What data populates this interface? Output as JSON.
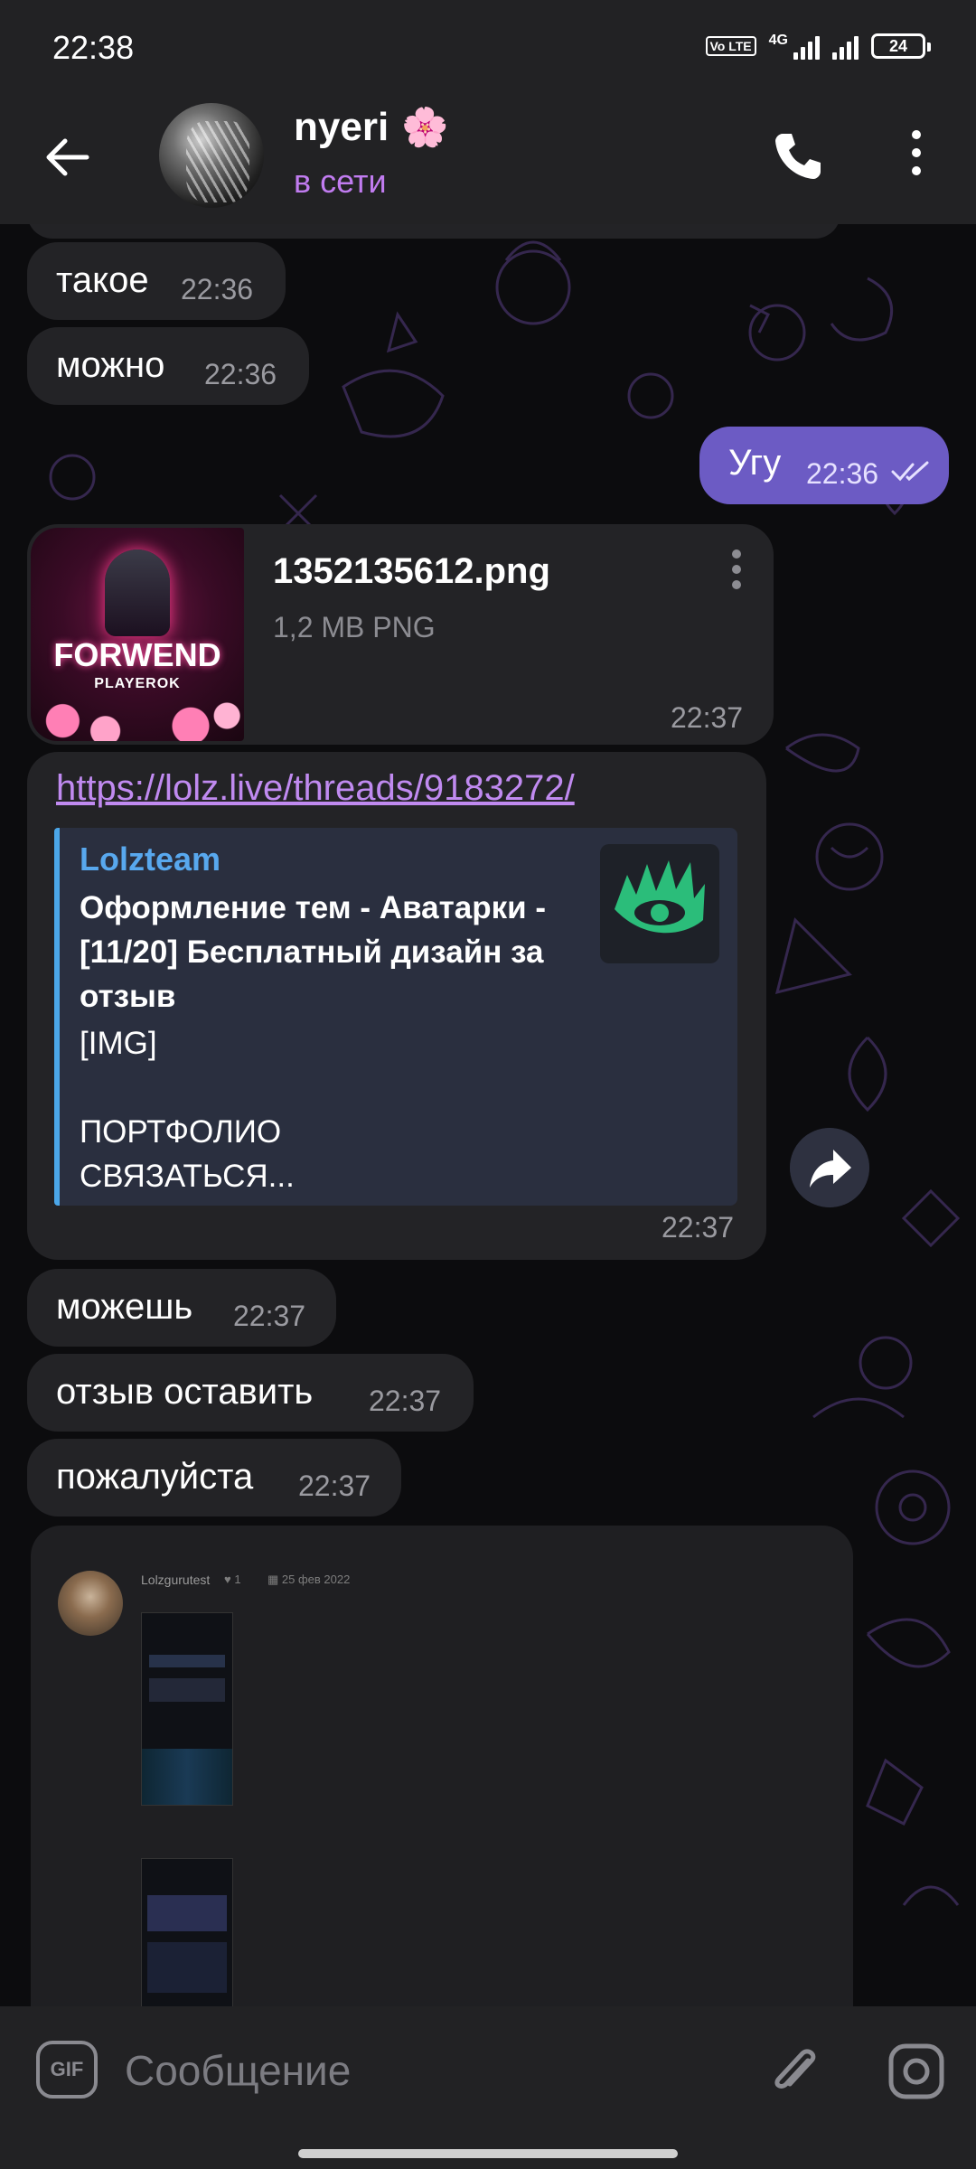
{
  "status_bar": {
    "time": "22:38",
    "volte": "Vo LTE",
    "network": "4G",
    "battery": "24"
  },
  "header": {
    "contact_name": "nyeri",
    "contact_emoji": "🌸",
    "status": "в сети"
  },
  "messages": [
    {
      "text": "такое",
      "time": "22:36"
    },
    {
      "text": "можно",
      "time": "22:36"
    },
    {
      "text": "Угу",
      "time": "22:36",
      "outgoing": true,
      "read": true
    }
  ],
  "file_message": {
    "filename": "1352135612.png",
    "meta": "1,2 MB PNG",
    "time": "22:37",
    "thumb_brand": "FORWEND",
    "thumb_sub": "PLAYEROK"
  },
  "link_message": {
    "url": "https://lolz.live/threads/9183272/",
    "site": "Lolzteam",
    "title": "Оформление тем - Аватарки - [11/20] Бесплатный дизайн за отзыв",
    "description": "[IMG]\n\nПОРТФОЛИО\nСВЯЗАТЬСЯ...",
    "time": "22:37"
  },
  "messages2": [
    {
      "text": "можешь",
      "time": "22:37"
    },
    {
      "text": "отзыв оставить",
      "time": "22:37"
    },
    {
      "text": "пожалуйста",
      "time": "22:37"
    }
  ],
  "screenshot_message": {
    "username": "Lolzgurutest",
    "likes": "♥ 1",
    "date": "▦ 25 фев 2022"
  },
  "input": {
    "placeholder": "Сообщение",
    "gif_label": "GIF"
  },
  "colors": {
    "accent": "#c17cf0",
    "outgoing_bubble": "#6c5bc4",
    "incoming_bubble": "#232326",
    "link_preview_bar": "#4ba6e8"
  }
}
